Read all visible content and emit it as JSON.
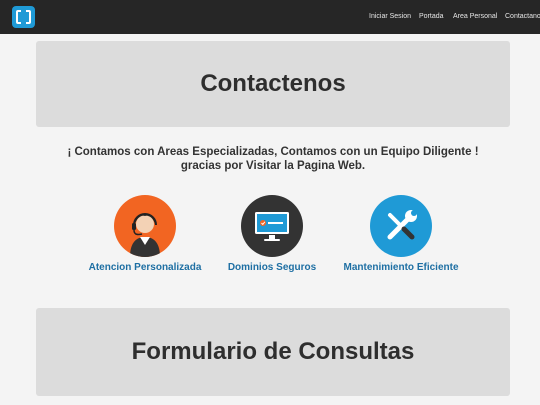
{
  "nav": {
    "items": [
      {
        "label": "Iniciar Sesion"
      },
      {
        "label": "Portada"
      },
      {
        "label": "Area Personal"
      },
      {
        "label": "Contactanos"
      }
    ]
  },
  "header": {
    "title": "Contactenos"
  },
  "slogan": {
    "line1": "¡ Contamos con Areas Especializadas, Contamos con un Equipo Diligente !",
    "line2": "gracias por Visitar la Pagina Web."
  },
  "services": [
    {
      "label": "Atencion Personalizada",
      "icon": "support-agent-icon",
      "color": "#f26522"
    },
    {
      "label": "Dominios Seguros",
      "icon": "secure-monitor-icon",
      "color": "#333333"
    },
    {
      "label": "Mantenimiento Eficiente",
      "icon": "tools-icon",
      "color": "#1f9ad6"
    }
  ],
  "form_section": {
    "title": "Formulario de Consultas"
  }
}
